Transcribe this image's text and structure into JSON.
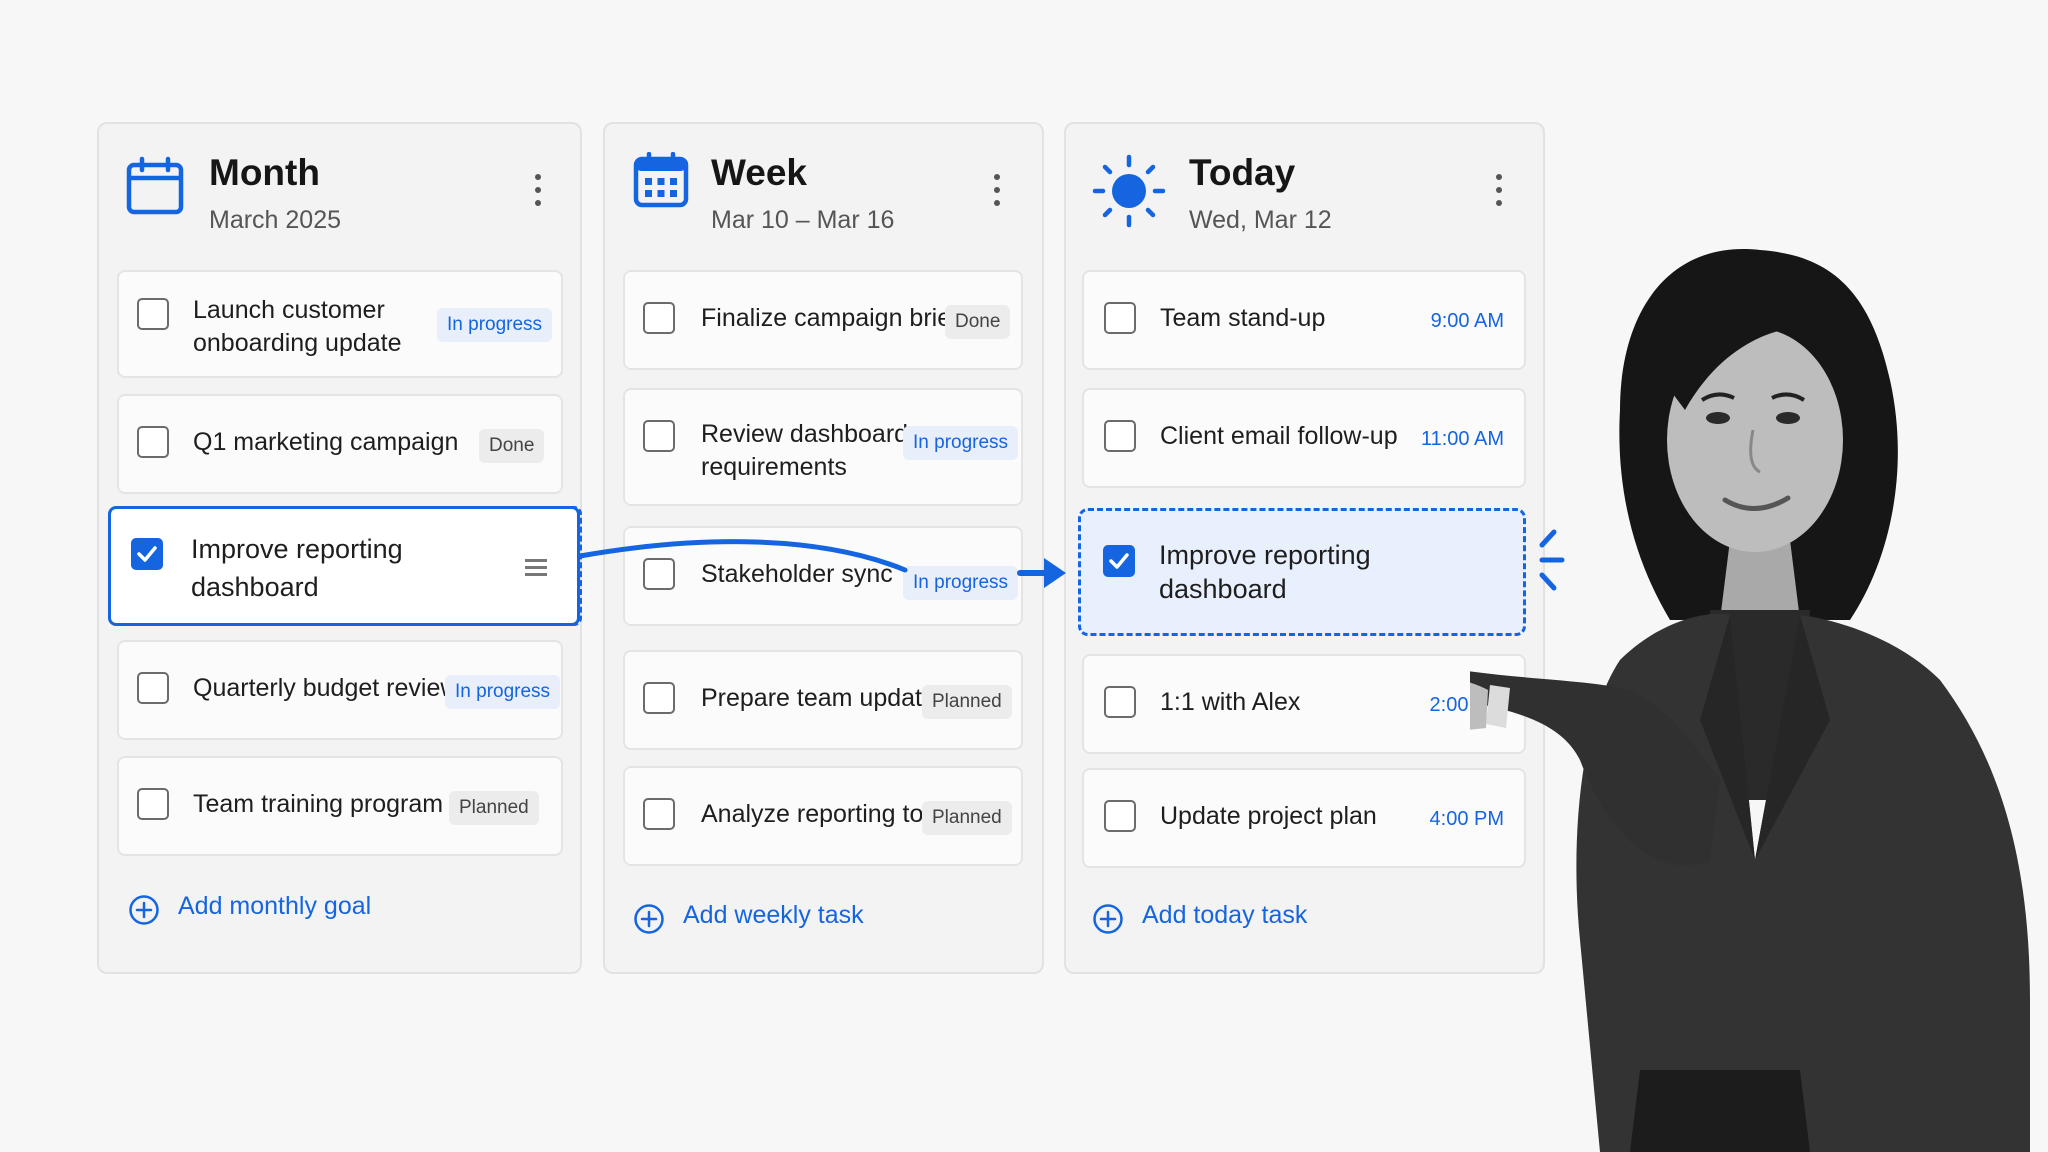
{
  "columns": {
    "month": {
      "title": "Month",
      "subtitle": "March 2025",
      "icon": "calendar-icon",
      "add_label": "Add monthly goal",
      "tasks": [
        {
          "label_1": "Launch customer",
          "label_2": "onboarding update",
          "status": "In progress",
          "checked": false
        },
        {
          "label": "Q1 marketing campaign",
          "status": "Done",
          "checked": false
        },
        {
          "label_1": "Improve reporting",
          "label_2": "dashboard",
          "status": "",
          "checked": true
        },
        {
          "label": "Quarterly budget review",
          "status": "In progress",
          "checked": false
        },
        {
          "label": "Team training program",
          "status": "Planned",
          "checked": false
        }
      ]
    },
    "week": {
      "title": "Week",
      "subtitle": "Mar 10 – Mar 16",
      "icon": "calendar-grid-icon",
      "add_label": "Add weekly task",
      "tasks": [
        {
          "label": "Finalize campaign brief",
          "status": "Done",
          "checked": false
        },
        {
          "label_1": "Review dashboard",
          "label_2": "requirements",
          "status": "In progress",
          "checked": false
        },
        {
          "label": "Stakeholder sync",
          "status": "In progress",
          "checked": false
        },
        {
          "label": "Prepare team update",
          "status": "Planned",
          "checked": false
        },
        {
          "label": "Analyze reporting tools",
          "status": "Planned",
          "checked": false
        }
      ]
    },
    "today": {
      "title": "Today",
      "subtitle": "Wed, Mar 12",
      "icon": "sun-icon",
      "add_label": "Add today task",
      "tasks": [
        {
          "label": "Team stand-up",
          "time": "9:00 AM",
          "checked": false
        },
        {
          "label": "Client email follow-up",
          "time": "11:00 AM",
          "checked": false
        },
        {
          "label_1": "Improve reporting",
          "label_2": "dashboard",
          "time": "",
          "checked": true
        },
        {
          "label": "1:1 with Alex",
          "time": "2:00 PM",
          "checked": false
        },
        {
          "label": "Update project plan",
          "time": "4:00 PM",
          "checked": false
        }
      ]
    }
  },
  "colors": {
    "accent": "#1565e0",
    "badge_progress_bg": "#e8eefa",
    "badge_neutral_bg": "#ececec",
    "drop_zone_bg": "#e9f0fd"
  }
}
